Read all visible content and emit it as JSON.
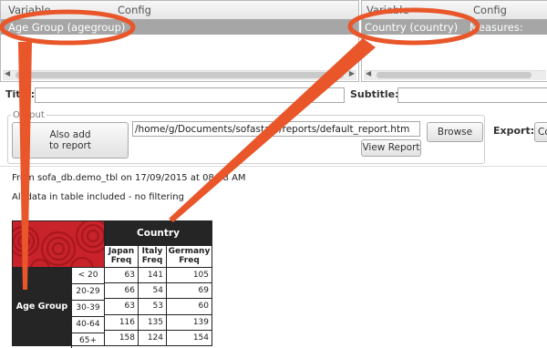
{
  "rows_pane": {
    "headers": [
      "Variable",
      "Config"
    ],
    "row": "Age Group (agegroup)"
  },
  "cols_pane": {
    "headers": [
      "Variable",
      "Config"
    ],
    "row_variable": "Country (country)",
    "row_config": "Measures: Freq"
  },
  "title_label": "Title:",
  "subtitle_label": "Subtitle:",
  "output": {
    "label": "Output",
    "also_add_line1": "Also add",
    "also_add_line2": "to report",
    "path": "/home/g/Documents/sofastats/reports/default_report.htm",
    "browse": "Browse",
    "view_report": "View Report",
    "export_label": "Export:",
    "export_btn": "Co"
  },
  "report": {
    "source_line": "From sofa_db.demo_tbl on 17/09/2015 at 08:08 AM",
    "filter_line": "All data in table included - no filtering",
    "col_var": "Country",
    "row_var": "Age Group",
    "countries": [
      "Japan",
      "Italy",
      "Germany"
    ],
    "measure": "Freq",
    "rows": [
      {
        "label": "< 20",
        "values": [
          63,
          141,
          105
        ]
      },
      {
        "label": "20-29",
        "values": [
          66,
          54,
          69
        ]
      },
      {
        "label": "30-39",
        "values": [
          63,
          53,
          60
        ]
      },
      {
        "label": "40-64",
        "values": [
          116,
          135,
          139
        ]
      },
      {
        "label": "65+",
        "values": [
          158,
          124,
          154
        ]
      }
    ]
  },
  "colors": {
    "callout": "#e8562a",
    "header_red": "#c8222a",
    "header_dark": "#252525",
    "selected_row": "#a6a6a6"
  }
}
